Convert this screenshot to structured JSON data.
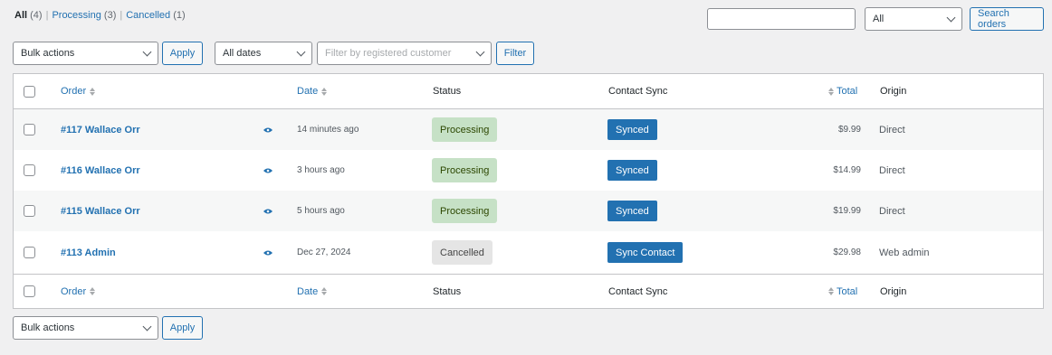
{
  "views": [
    {
      "label": "All",
      "count": "(4)"
    },
    {
      "label": "Processing",
      "count": "(3)"
    },
    {
      "label": "Cancelled",
      "count": "(1)"
    }
  ],
  "separator": "|",
  "search": {
    "value": "",
    "type_select": "All",
    "button": "Search orders"
  },
  "filters": {
    "bulk_actions": "Bulk actions",
    "apply": "Apply",
    "dates": "All dates",
    "customer_placeholder": "Filter by registered customer",
    "filter_button": "Filter"
  },
  "columns": {
    "order": "Order",
    "date": "Date",
    "status": "Status",
    "contact_sync": "Contact Sync",
    "total": "Total",
    "origin": "Origin"
  },
  "orders": [
    {
      "order": "#117 Wallace Orr",
      "date": "14 minutes ago",
      "status": "Processing",
      "status_type": "processing",
      "sync": "Synced",
      "total": "$9.99",
      "origin": "Direct"
    },
    {
      "order": "#116 Wallace Orr",
      "date": "3 hours ago",
      "status": "Processing",
      "status_type": "processing",
      "sync": "Synced",
      "total": "$14.99",
      "origin": "Direct"
    },
    {
      "order": "#115 Wallace Orr",
      "date": "5 hours ago",
      "status": "Processing",
      "status_type": "processing",
      "sync": "Synced",
      "total": "$19.99",
      "origin": "Direct"
    },
    {
      "order": "#113 Admin",
      "date": "Dec 27, 2024",
      "status": "Cancelled",
      "status_type": "cancelled",
      "sync": "Sync Contact",
      "total": "$29.98",
      "origin": "Web admin"
    }
  ],
  "bottom": {
    "bulk_actions": "Bulk actions",
    "apply": "Apply"
  },
  "icons": {
    "preview": "eye-icon",
    "sort": "sort-arrows-icon",
    "dropdown": "chevron-down-icon"
  },
  "colors": {
    "accent": "#2271b1",
    "processing_bg": "#c6e1c6",
    "cancelled_bg": "#e5e5e5"
  }
}
